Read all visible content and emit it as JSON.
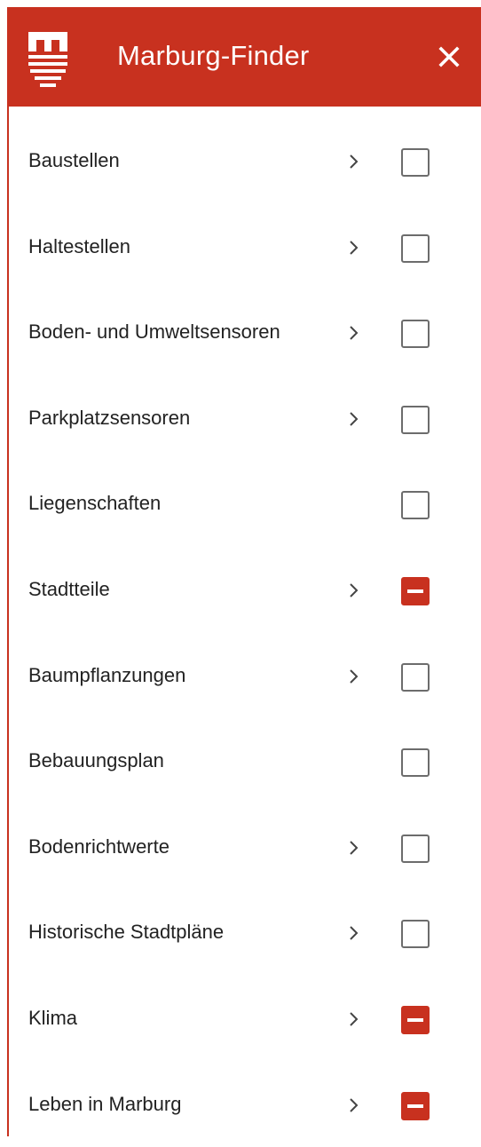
{
  "app": {
    "title": "Marburg-Finder",
    "accent": "#c8311f",
    "logo_icon": "marburg-logo-icon",
    "close_icon": "close-icon"
  },
  "layers": [
    {
      "label": "Baustellen",
      "has_children": true,
      "state": "unchecked"
    },
    {
      "label": "Haltestellen",
      "has_children": true,
      "state": "unchecked"
    },
    {
      "label": "Boden- und Umweltsensoren",
      "has_children": true,
      "state": "unchecked"
    },
    {
      "label": "Parkplatzsensoren",
      "has_children": true,
      "state": "unchecked"
    },
    {
      "label": "Liegenschaften",
      "has_children": false,
      "state": "unchecked"
    },
    {
      "label": "Stadtteile",
      "has_children": true,
      "state": "indeterminate"
    },
    {
      "label": "Baumpflanzungen",
      "has_children": true,
      "state": "unchecked"
    },
    {
      "label": "Bebauungsplan",
      "has_children": false,
      "state": "unchecked"
    },
    {
      "label": "Bodenrichtwerte",
      "has_children": true,
      "state": "unchecked"
    },
    {
      "label": "Historische Stadtpläne",
      "has_children": true,
      "state": "unchecked"
    },
    {
      "label": "Klima",
      "has_children": true,
      "state": "indeterminate"
    },
    {
      "label": "Leben in Marburg",
      "has_children": true,
      "state": "indeterminate"
    }
  ]
}
